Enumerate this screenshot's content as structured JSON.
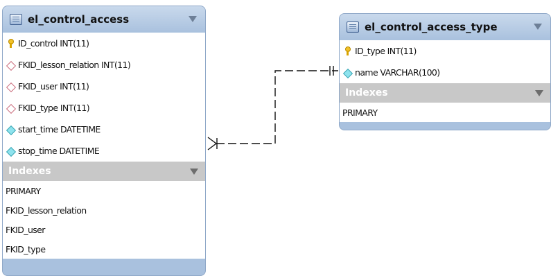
{
  "tables": {
    "left": {
      "title": "el_control_access",
      "columns": [
        {
          "icon": "primary-key-icon",
          "text": "ID_control INT(11)"
        },
        {
          "icon": "foreign-key-icon",
          "text": "FKID_lesson_relation INT(11)"
        },
        {
          "icon": "foreign-key-icon",
          "text": "FKID_user INT(11)"
        },
        {
          "icon": "foreign-key-icon",
          "text": "FKID_type INT(11)"
        },
        {
          "icon": "column-icon",
          "text": "start_time DATETIME"
        },
        {
          "icon": "column-icon",
          "text": "stop_time DATETIME"
        }
      ],
      "indexes_label": "Indexes",
      "indexes": [
        "PRIMARY",
        "FKID_lesson_relation",
        "FKID_user",
        "FKID_type"
      ]
    },
    "right": {
      "title": "el_control_access_type",
      "columns": [
        {
          "icon": "primary-key-icon",
          "text": "ID_type INT(11)"
        },
        {
          "icon": "column-icon",
          "text": "name VARCHAR(100)"
        }
      ],
      "indexes_label": "Indexes",
      "indexes": [
        "PRIMARY"
      ]
    }
  },
  "relationship": {
    "from": "el_control_access",
    "to": "el_control_access_type",
    "cardinality": "many-to-one",
    "style": "dashed"
  },
  "colors": {
    "header": "#a9c1de",
    "index_header": "#c8c8c8",
    "border": "#8fa8c8"
  }
}
